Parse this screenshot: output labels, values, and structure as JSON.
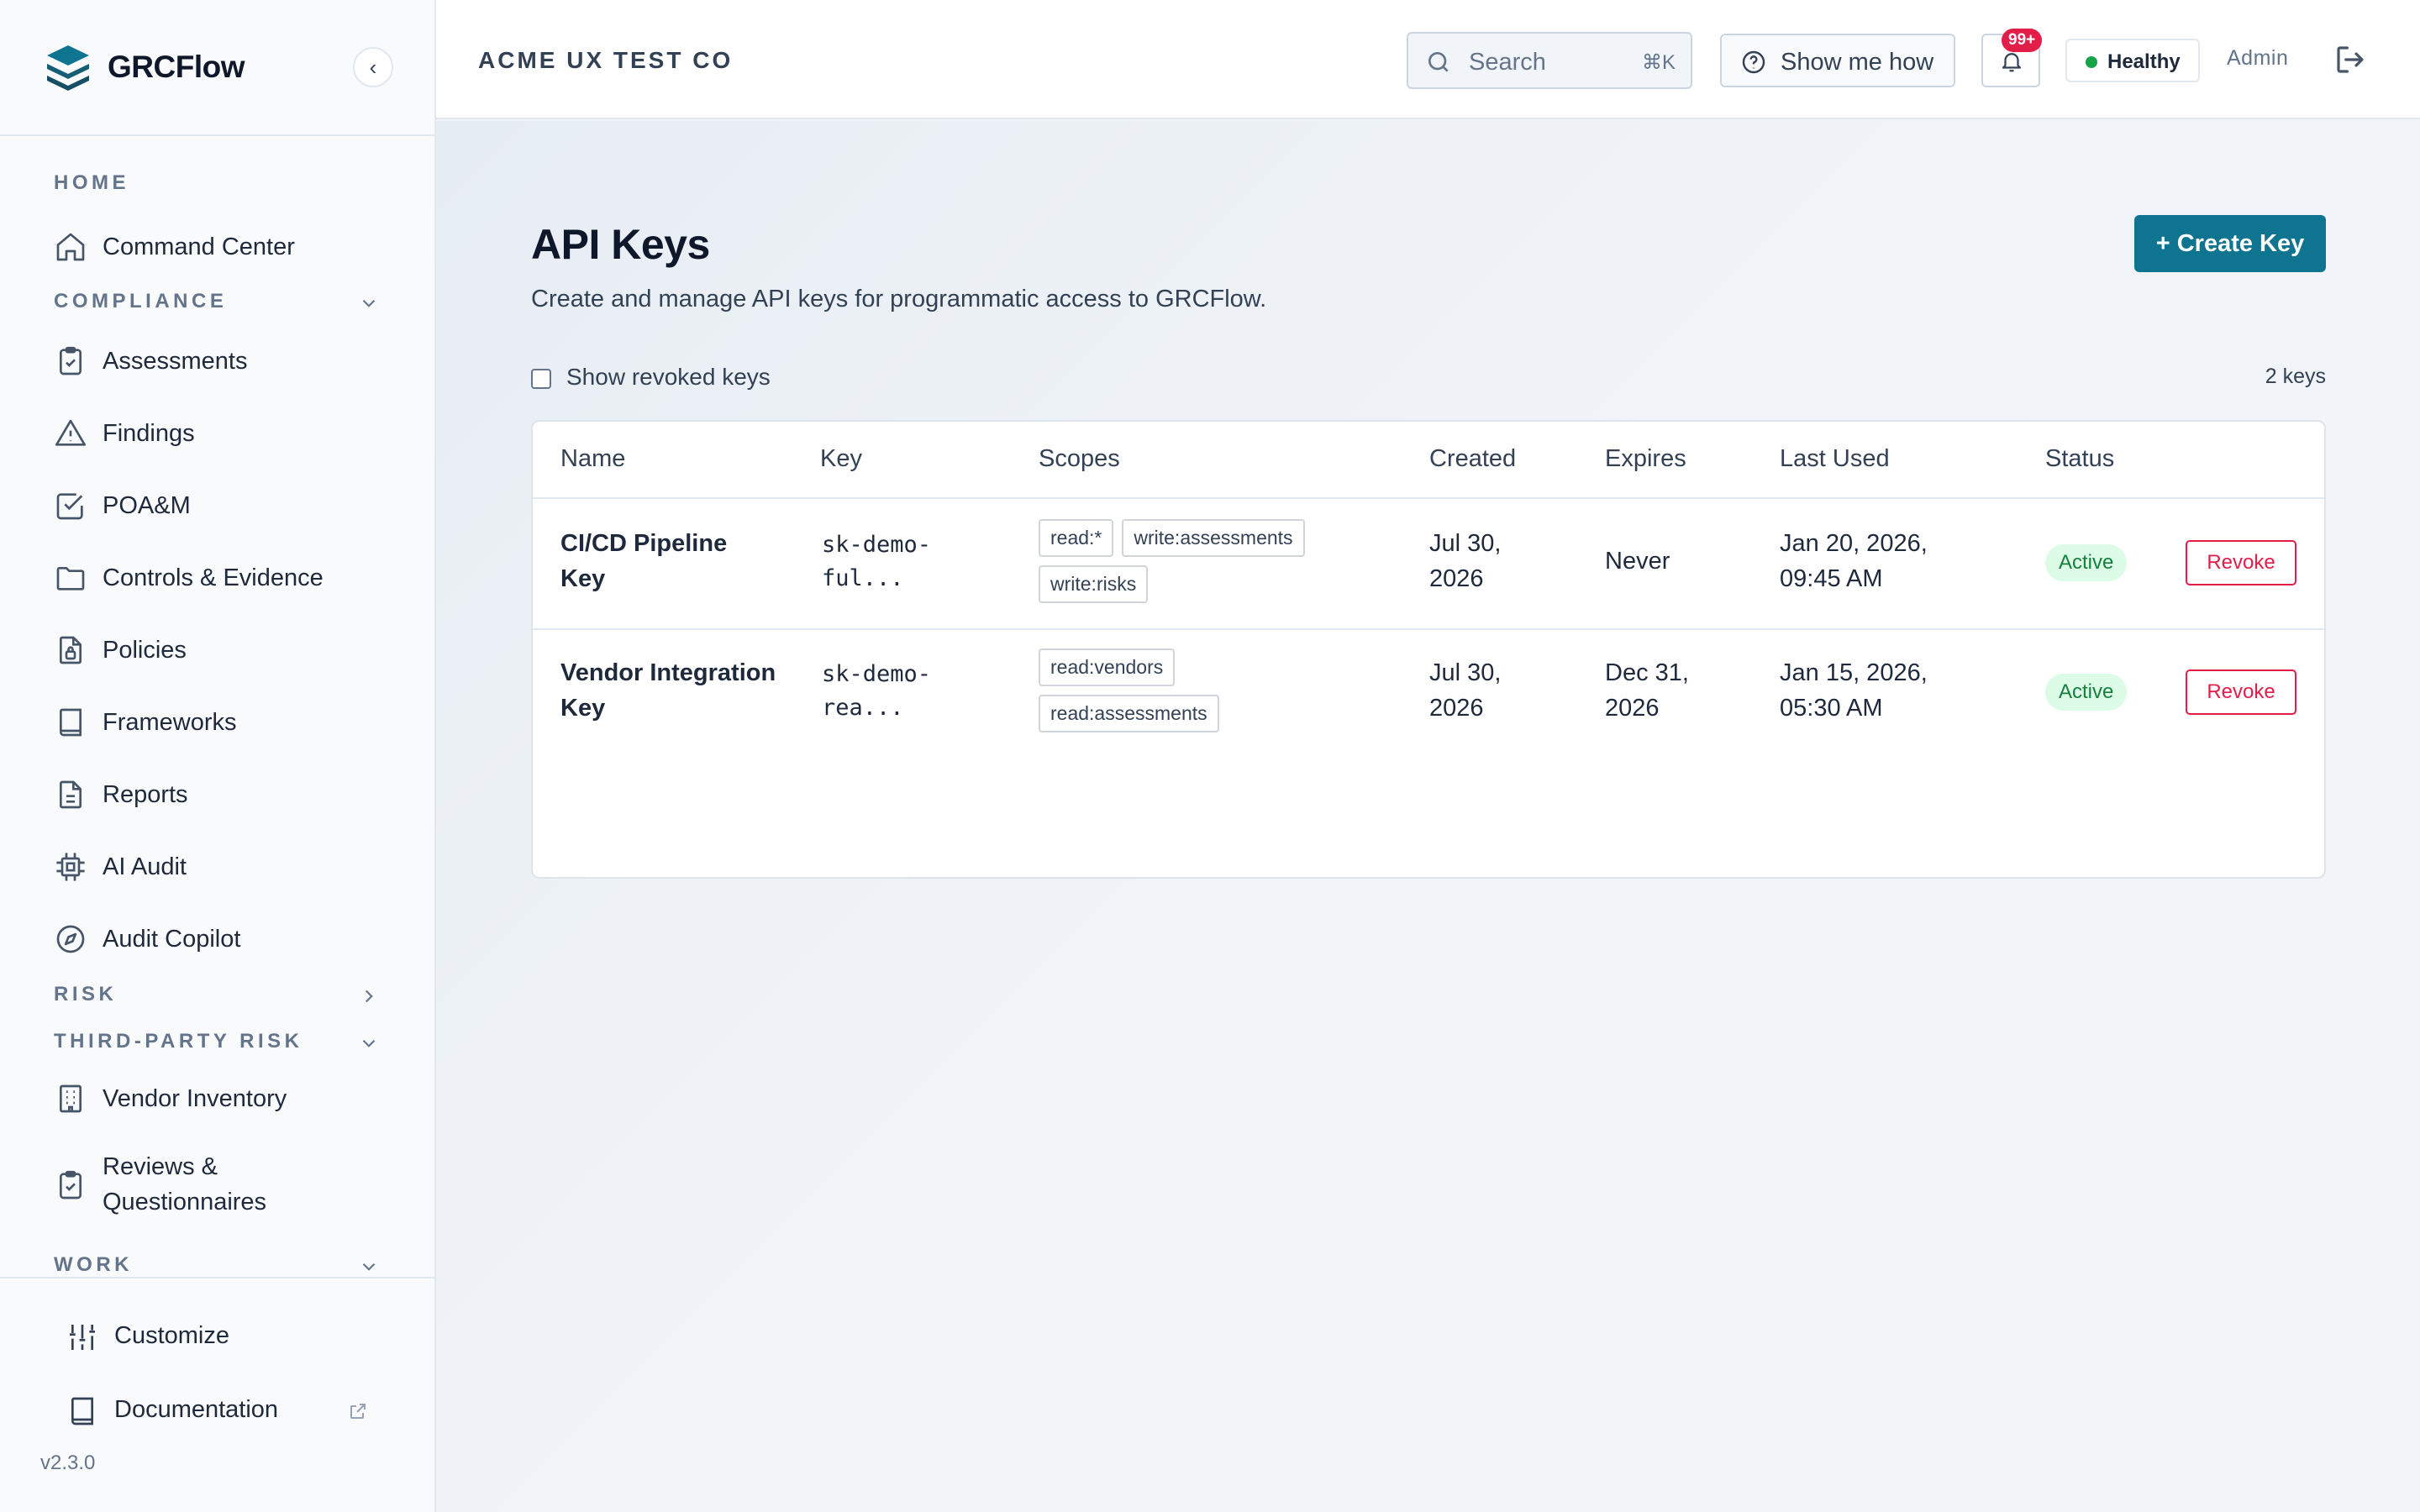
{
  "brand": {
    "name": "GRCFlow",
    "collapse_glyph": "‹"
  },
  "nav": {
    "home_section": "HOME",
    "compliance_section": "COMPLIANCE",
    "risk_section": "RISK",
    "third_party_section": "THIRD-PARTY RISK",
    "work_section": "WORK",
    "items": {
      "command_center": "Command Center",
      "assessments": "Assessments",
      "findings": "Findings",
      "poam": "POA&M",
      "controls": "Controls & Evidence",
      "policies": "Policies",
      "frameworks": "Frameworks",
      "reports": "Reports",
      "ai_audit": "AI Audit",
      "audit_copilot": "Audit Copilot",
      "vendor_inventory": "Vendor Inventory",
      "reviews_line1": "Reviews &",
      "reviews_line2": "Questionnaires"
    }
  },
  "sidebar_footer": {
    "customize": "Customize",
    "documentation": "Documentation",
    "version": "v2.3.0"
  },
  "header": {
    "org_name": "ACME UX TEST CO",
    "search_placeholder": "Search",
    "search_shortcut": "⌘K",
    "help_label": "Show me how",
    "notification_count": "99+",
    "health_label": "Healthy",
    "user_role": "Admin"
  },
  "page": {
    "title": "API Keys",
    "subtitle": "Create and manage API keys for programmatic access to GRCFlow.",
    "create_label": "+ Create Key",
    "show_revoked_label": "Show revoked keys",
    "key_count": "2 keys"
  },
  "table": {
    "columns": [
      "Name",
      "Key",
      "Scopes",
      "Created",
      "Expires",
      "Last Used",
      "Status"
    ],
    "rows": [
      {
        "name_line1": "CI/CD Pipeline",
        "name_line2": "Key",
        "key_line1": "sk-demo-",
        "key_line2": "ful...",
        "scopes": [
          "read:*",
          "write:assessments",
          "write:risks"
        ],
        "created_line1": "Jul 30,",
        "created_line2": "2026",
        "expires_line1": "Never",
        "expires_line2": "",
        "last_used_line1": "Jan 20, 2026,",
        "last_used_line2": "09:45 AM",
        "status": "Active",
        "action": "Revoke"
      },
      {
        "name_line1": "Vendor Integration",
        "name_line2": "Key",
        "key_line1": "sk-demo-",
        "key_line2": "rea...",
        "scopes": [
          "read:vendors",
          "read:assessments"
        ],
        "created_line1": "Jul 30,",
        "created_line2": "2026",
        "expires_line1": "Dec 31,",
        "expires_line2": "2026",
        "last_used_line1": "Jan 15, 2026,",
        "last_used_line2": "05:30 AM",
        "status": "Active",
        "action": "Revoke"
      }
    ]
  },
  "colors": {
    "accent": "#0e7490",
    "danger": "#e11d48",
    "success": "#16a34a",
    "badge_bg": "#dcfce7"
  }
}
